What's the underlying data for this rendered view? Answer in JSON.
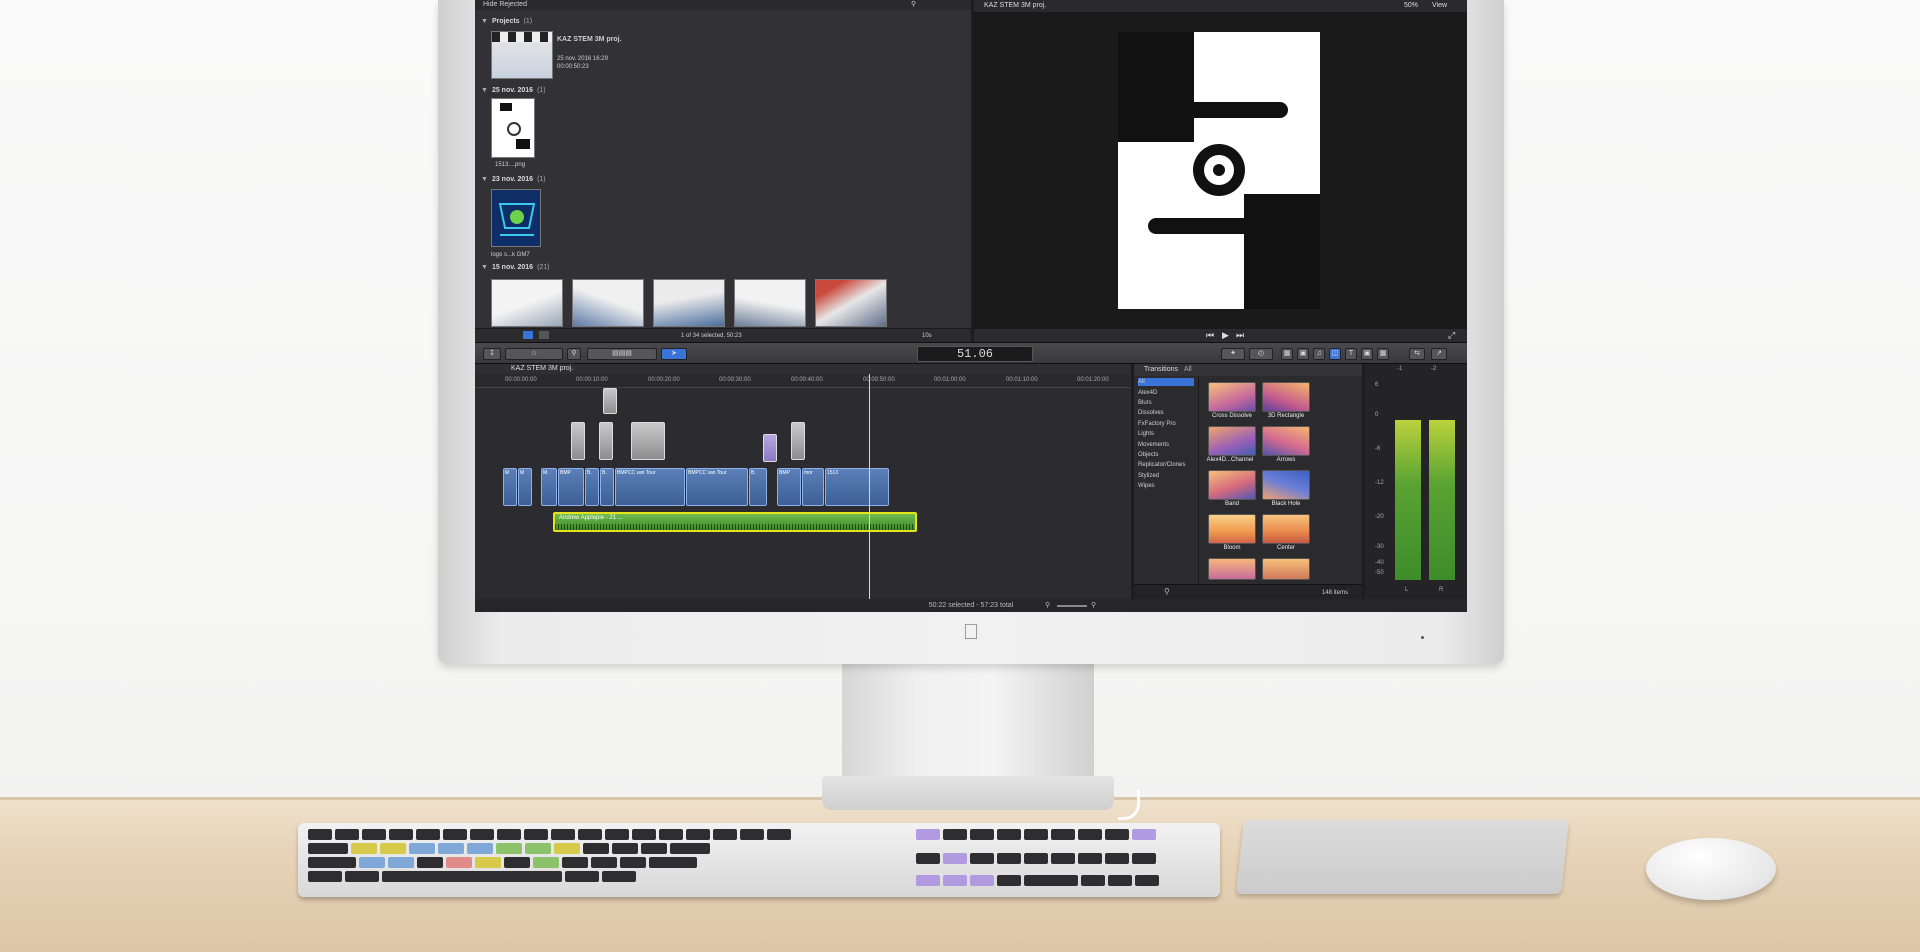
{
  "browser": {
    "filter_label": "Hide Rejected",
    "projects": {
      "label": "Projects",
      "count": "(1)",
      "name": "KAZ STEM 3M proj.",
      "date": "25 nov. 2016 16:29",
      "duration": "00:00:50:23"
    },
    "group1": {
      "label": "25 nov. 2016",
      "count": "(1)",
      "file": "1513....png"
    },
    "group2": {
      "label": "23 nov. 2016",
      "count": "(1)",
      "file": "logo s...k GM7"
    },
    "group3": {
      "label": "15 nov. 2016",
      "count": "(21)"
    },
    "selection_status": "1 of 34 selected, 50:23",
    "duration_setting": "10s"
  },
  "viewer": {
    "title": "KAZ STEM 3M proj.",
    "zoom": "50%",
    "view_menu": "View"
  },
  "toolbar": {
    "timecode": "51.06"
  },
  "timeline": {
    "project_name": "KAZ STEM 3M proj.",
    "ruler": [
      "00:00:00:00",
      "00:00:10:00",
      "00:00:20:00",
      "00:00:30:00",
      "00:00:40:00",
      "00:00:50:00",
      "00:01:00:00",
      "00:01:10:00",
      "00:01:20:00"
    ],
    "clips": [
      "M",
      "M",
      "M.",
      "BMP",
      "B.",
      "B.",
      "BMPCC van Tour",
      "BMPCC van Tour",
      "B.",
      "BMP",
      "mor",
      "1513"
    ],
    "audio_clip_label": "Andrew Applepie - 21 ...",
    "status": "50:22 selected - 57:23 total"
  },
  "transitions": {
    "title": "Transitions",
    "filter": "All",
    "categories": [
      "All",
      "Alex4D",
      "Blurs",
      "Dissolves",
      "FxFactory Pro",
      "Lights",
      "Movements",
      "Objects",
      "Replicator/Clones",
      "Stylized",
      "Wipes"
    ],
    "items": [
      "Cross Dissolve",
      "3D Rectangle",
      "Alex4D...Channel",
      "Arrows",
      "Band",
      "Black Hole",
      "Bloom",
      "Center"
    ],
    "count": "148 items"
  },
  "meters": {
    "ticks": [
      "6",
      "0",
      "-6",
      "-12",
      "-20",
      "-30",
      "-40",
      "-50"
    ],
    "channels": [
      "L",
      "R"
    ],
    "top_labels": [
      "-1",
      "-2"
    ]
  },
  "colors": {
    "accent_selection": "#e6e31a",
    "video_clip": "#4a6ca5",
    "audio_clip": "#4f9b36"
  }
}
